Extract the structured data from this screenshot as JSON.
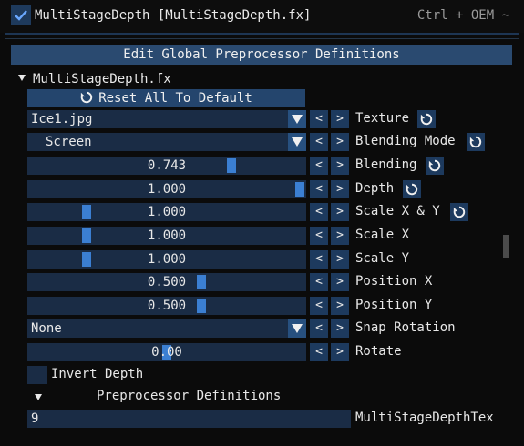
{
  "top": {
    "enabled": true,
    "title": "MultiStageDepth [MultiStageDepth.fx]",
    "shortcut": "Ctrl + OEM ~"
  },
  "panel": {
    "header": "Edit Global Preprocessor Definitions",
    "effect_name": "MultiStageDepth.fx",
    "reset_all": "Reset All To Default"
  },
  "controls": {
    "texture": {
      "value": "Ice1.jpg",
      "label": "Texture"
    },
    "blending_mode": {
      "value": "Screen",
      "label": "Blending Mode"
    },
    "blending": {
      "value": "0.743",
      "label": "Blending",
      "level": 0.743
    },
    "depth": {
      "value": "1.000",
      "label": "Depth",
      "level": 1.0
    },
    "scale_xy": {
      "value": "1.000",
      "label": "Scale X & Y",
      "level": 0.2
    },
    "scale_x": {
      "value": "1.000",
      "label": "Scale X",
      "level": 0.2
    },
    "scale_y": {
      "value": "1.000",
      "label": "Scale Y",
      "level": 0.2
    },
    "position_x": {
      "value": "0.500",
      "label": "Position X",
      "level": 0.63
    },
    "position_y": {
      "value": "0.500",
      "label": "Position Y",
      "level": 0.63
    },
    "snap_rotation": {
      "value": "None",
      "label": "Snap Rotation"
    },
    "rotate": {
      "value": "0.00",
      "label": "Rotate",
      "level": 0.5
    },
    "invert_depth": {
      "label": "Invert Depth",
      "checked": false
    }
  },
  "preprocessor": {
    "header": "Preprocessor Definitions",
    "value": "9",
    "name": "MultiStageDepthTex"
  },
  "buttons": {
    "prev": "<",
    "next": ">"
  },
  "colors": {
    "accent": "#3b7fd2",
    "frame": "#1a2c45",
    "header": "#2a4a70"
  }
}
